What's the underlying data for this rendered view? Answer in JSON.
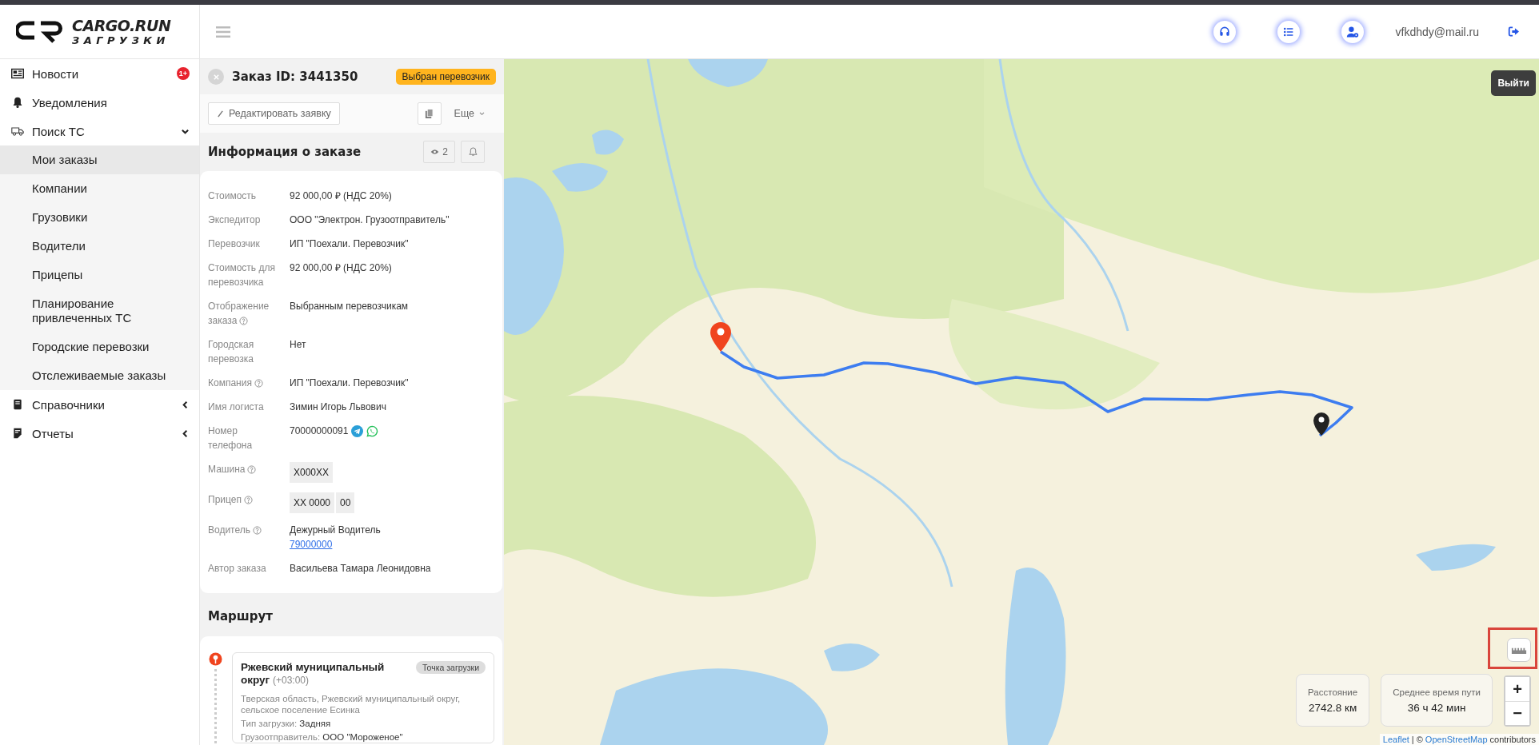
{
  "logo": {
    "name": "CARGO.RUN",
    "subtitle": "ЗАГРУЗКИ"
  },
  "header": {
    "email": "vfkdhdy@mail.ru"
  },
  "sidebar": {
    "items": [
      {
        "label": "Новости",
        "badge": "1+"
      },
      {
        "label": "Уведомления"
      },
      {
        "label": "Поиск ТС",
        "expanded": true,
        "children": [
          {
            "label": "Мои заказы",
            "selected": true
          },
          {
            "label": "Компании",
            "selected": false
          },
          {
            "label": "Грузовики",
            "selected": false
          },
          {
            "label": "Водители",
            "selected": false
          },
          {
            "label": "Прицепы",
            "selected": false
          },
          {
            "label": "Планирование привлеченных ТС",
            "selected": false
          },
          {
            "label": "Городские перевозки",
            "selected": false
          },
          {
            "label": "Отслеживаемые заказы",
            "selected": false
          }
        ]
      },
      {
        "label": "Справочники",
        "expanded": false
      },
      {
        "label": "Отчеты",
        "expanded": false
      }
    ]
  },
  "order": {
    "title": "Заказ ID: 3441350",
    "status": "Выбран перевозчик",
    "edit_button": "Редактировать заявку",
    "more_button": "Еще"
  },
  "info": {
    "title": "Информация о заказе",
    "views": "2",
    "rows": [
      {
        "kind": "text",
        "label": "Стоимость",
        "value": "92 000,00 ₽ (НДС 20%)",
        "help": false
      },
      {
        "kind": "text",
        "label": "Экспедитор",
        "value": "ООО \"Электрон. Грузоотправитель\"",
        "help": false
      },
      {
        "kind": "text",
        "label": "Перевозчик",
        "value": "ИП \"Поехали. Перевозчик\"",
        "help": false
      },
      {
        "kind": "text",
        "label": "Стоимость для перевозчика",
        "value": "92 000,00 ₽ (НДС 20%)",
        "help": false
      },
      {
        "kind": "text",
        "label": "Отображение заказа",
        "value": "Выбранным перевозчикам",
        "help": true
      },
      {
        "kind": "text",
        "label": "Городская перевозка",
        "value": "Нет",
        "help": false
      },
      {
        "kind": "text",
        "label": "Компания",
        "value": "ИП \"Поехали. Перевозчик\"",
        "help": true
      },
      {
        "kind": "text",
        "label": "Имя логиста",
        "value": "Зимин Игорь Львович",
        "help": false
      },
      {
        "kind": "phone",
        "label": "Номер телефона",
        "value": "70000000091",
        "help": false
      },
      {
        "kind": "plate",
        "label": "Машина",
        "parts": [
          "X000XX"
        ],
        "help": true
      },
      {
        "kind": "plate",
        "label": "Прицеп",
        "parts": [
          "XX 0000",
          "00"
        ],
        "help": true
      },
      {
        "kind": "driver",
        "label": "Водитель",
        "value": "Дежурный Водитель",
        "link": "79000000",
        "help": true
      },
      {
        "kind": "text",
        "label": "Автор заказа",
        "value": "Васильева Тамара Леонидовна",
        "help": false
      }
    ]
  },
  "route": {
    "title": "Маршрут",
    "points": [
      {
        "name": "Ржевский муниципальный округ",
        "tz": "(+03:00)",
        "tag": "Точка загрузки",
        "address": "Тверская область, Ржевский муниципальный округ, сельское поселение Есинка",
        "load_label": "Тип загрузки:",
        "load_type": "Задняя",
        "shipper_label": "Грузоотправитель:",
        "shipper": "ООО \"Мороженое\""
      }
    ]
  },
  "map": {
    "tooltip": "Выйти",
    "stats": [
      {
        "label": "Расстояние",
        "value": "2742.8 км"
      },
      {
        "label": "Среднее время пути",
        "value": "36 ч 42 мин"
      }
    ],
    "zoom_in": "+",
    "zoom_out": "−",
    "attribution": {
      "leaflet": "Leaflet",
      "separator": "| ©",
      "osm": "OpenStreetMap",
      "rest": "contributors"
    }
  }
}
